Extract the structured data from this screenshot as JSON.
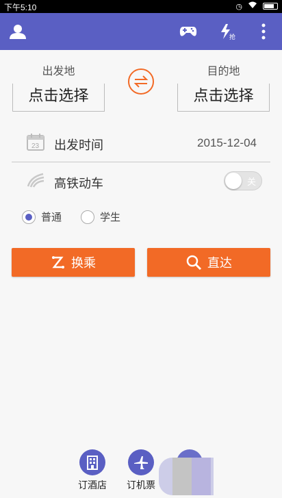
{
  "status_bar": {
    "time": "下午5:10"
  },
  "route": {
    "from_label": "出发地",
    "from_value": "点击选择",
    "to_label": "目的地",
    "to_value": "点击选择"
  },
  "date_row": {
    "label": "出发时间",
    "value": "2015-12-04",
    "calendar_day": "23"
  },
  "high_speed": {
    "label": "高铁动车",
    "toggle_text": "关",
    "enabled": false
  },
  "ticket_type": {
    "options": [
      "普通",
      "学生"
    ],
    "selected": "普通"
  },
  "actions": {
    "transfer_label": "换乘",
    "direct_label": "直达"
  },
  "bottom_nav": {
    "hotel_label": "订酒店",
    "flight_label": "订机票"
  },
  "colors": {
    "primary": "#5a5fc3",
    "accent": "#f26a26"
  },
  "icons": {
    "app_bar": [
      "user-icon",
      "gamepad-icon",
      "grab-ticket-icon",
      "more-vert-icon"
    ],
    "swap": "swap-icon",
    "date": "calendar-icon",
    "high_speed": "train-icon",
    "transfer": "transfer-icon",
    "direct": "search-icon"
  }
}
